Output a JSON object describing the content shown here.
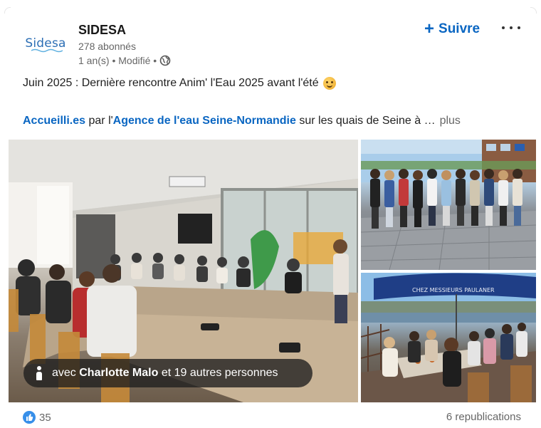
{
  "company": {
    "logo_text": "Sidesa",
    "name": "SIDESA",
    "followers": "278 abonnés",
    "meta": "1 an(s) • Modifié •",
    "follow_label": "Suivre",
    "follow_icon": "plus-icon",
    "more_icon": "ellipsis-icon",
    "visibility_icon": "globe-icon"
  },
  "post": {
    "line1": "Juin 2025 : Dernière rencontre Anim' l'Eau 2025 avant l'été",
    "line1_emoji": "smiling-face-emoji",
    "line2": {
      "link1": "Accueilli.es",
      "text1": " par l'",
      "link2": "Agence de l'eau Seine-Normandie",
      "text2": " sur les quais de Seine à ",
      "ellipsis": "…",
      "more": "plus"
    }
  },
  "media": {
    "tag_prefix": "avec",
    "tag_name": "Charlotte Malo",
    "tag_suffix": "et 19 autres personnes",
    "tag_icon": "person-icon",
    "awning_text": "CHEZ MESSIEURS PAULANER"
  },
  "footer": {
    "reaction_icon": "like-icon",
    "reactions_count": "35",
    "reposts": "6 republications"
  },
  "colors": {
    "brand": "#0a66c2",
    "muted": "#666666",
    "like_blue": "#378fe9"
  }
}
